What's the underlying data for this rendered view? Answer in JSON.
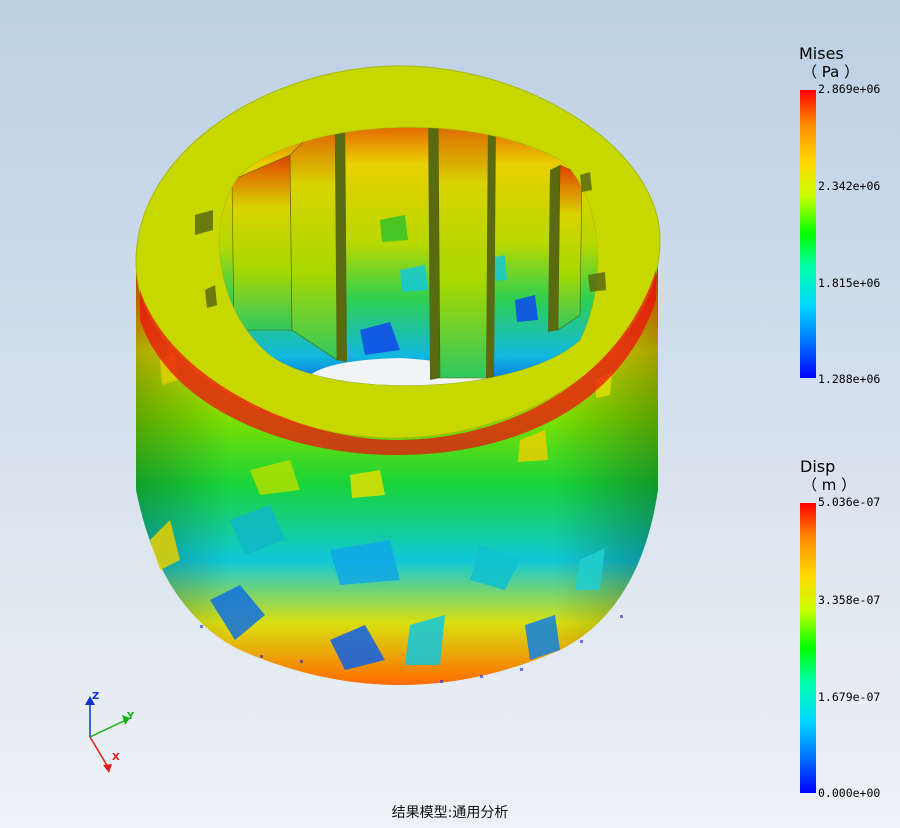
{
  "legends": {
    "mises": {
      "title": "Mises",
      "unit": "（ Pa ）",
      "ticks": [
        "2.869e+06",
        "2.342e+06",
        "1.815e+06",
        "1.288e+06"
      ]
    },
    "disp": {
      "title": "Disp",
      "unit": "（ m ）",
      "ticks": [
        "5.036e-07",
        "3.358e-07",
        "1.679e-07",
        "0.000e+00"
      ]
    }
  },
  "triad": {
    "x": "X",
    "y": "Y",
    "z": "Z"
  },
  "caption": "结果模型:通用分析",
  "colors": {
    "rim": "#c6d800",
    "bg_top": "#bcd0e4",
    "bg_bottom": "#eef2f6",
    "high": "#ff0000",
    "mid": "#00ff00",
    "low": "#0000ff"
  }
}
